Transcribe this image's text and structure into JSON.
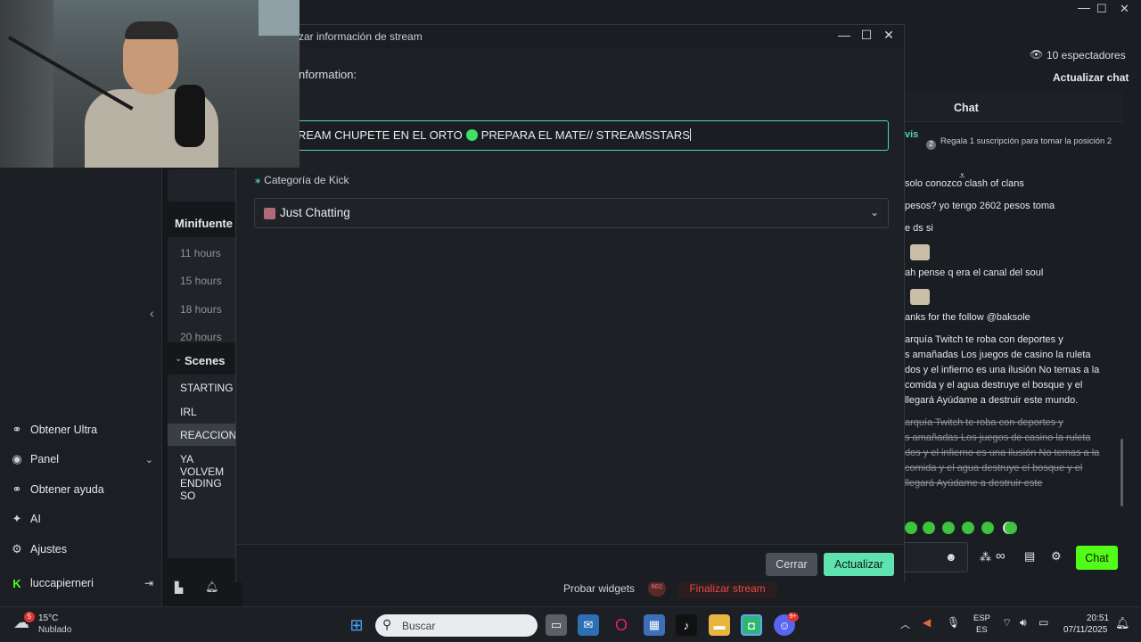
{
  "sidebar": {
    "items": [
      {
        "label": "Obtener Ultra",
        "icon": "ultra-icon"
      },
      {
        "label": "Panel",
        "icon": "panel-icon"
      },
      {
        "label": "Obtener ayuda",
        "icon": "help-icon"
      },
      {
        "label": "AI",
        "icon": "ai-sparkle-icon"
      },
      {
        "label": "Ajustes",
        "icon": "gear-icon"
      },
      {
        "label": "luccapierneri",
        "icon": "kick-logo-icon"
      }
    ]
  },
  "middle": {
    "minifuente_title": "Minifuente",
    "minifuente_items": [
      "11 hours",
      "15 hours",
      "18 hours",
      "20 hours"
    ],
    "scenes_title": "Scenes",
    "scenes": [
      "STARTING",
      "IRL",
      "REACCION",
      "YA VOLVEM",
      "ENDING SO"
    ]
  },
  "dialog": {
    "title": "zar información de stream",
    "section_label": "nformation:",
    "stream_title_part1": "REAM CHUPETE EN EL ORTO",
    "stream_title_part2": "PREPARA EL MATE// STREAMSSTARS",
    "category_label": "Categoría de Kick",
    "category_value": "Just Chatting",
    "cancel_label": "Cerrar",
    "update_label": "Actualizar"
  },
  "bottom_bar": {
    "test_widgets": "Probar widgets",
    "rec_badge": "REC",
    "end_stream": "Finalizar stream"
  },
  "chat": {
    "viewers": "10 espectadores",
    "update_chat": "Actualizar chat",
    "header": "Chat",
    "user_partial": "vis",
    "gift_promo": "Regala 1 suscripción para tomar la posición 2",
    "lines": [
      "solo conozco clash of clans",
      "pesos? yo tengo 2602 pesos toma",
      "e ds si",
      "ah pense q era el canal del soul",
      "anks for the follow @baksole",
      "arquía Twitch te roba con deportes y",
      "s amañadas Los juegos de casino la ruleta",
      "dos y el infierno es una ilusión No temas a la",
      "comida y el agua destruye el bosque y el",
      "llegará Ayúdame a destruir este mundo."
    ],
    "strike_lines": [
      "arquía Twitch te roba con deportes y",
      "s amañadas Los juegos de casino la ruleta",
      "dos y el infierno es una ilusión No temas a la",
      "comida y el agua destruye el bosque y el",
      "llegará Ayúdame a destruir este"
    ],
    "send_label": "Chat"
  },
  "taskbar": {
    "weather_temp": "15°C",
    "weather_desc": "Nublado",
    "weather_badge": "5",
    "search_placeholder": "Buscar",
    "lang_top": "ESP",
    "lang_bottom": "ES",
    "time": "20:51",
    "date": "07/11/2025",
    "discord_badge": "9+"
  },
  "colors": {
    "accent_green": "#53fc18",
    "button_mint": "#5ee3b0",
    "end_stream_red": "#e34949"
  }
}
